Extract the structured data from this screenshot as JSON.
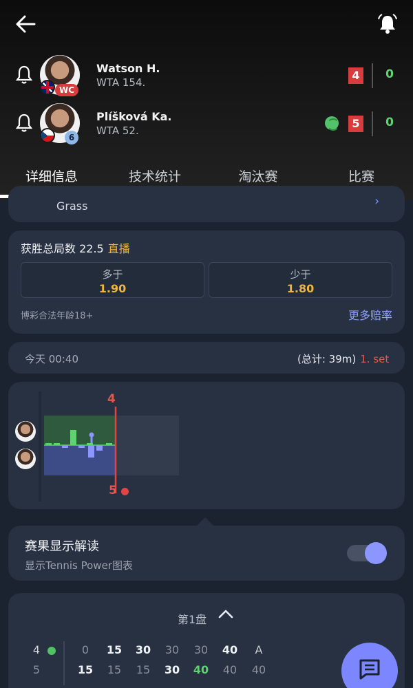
{
  "header": {
    "players": [
      {
        "name": "Watson H.",
        "rank": "WTA 154.",
        "badge": "WC",
        "sets": "4",
        "games": "0",
        "serving": false
      },
      {
        "name": "Plíšková Ka.",
        "rank": "WTA 52.",
        "badge": "6",
        "sets": "5",
        "games": "0",
        "serving": true
      }
    ]
  },
  "tabs": [
    "详细信息",
    "技术统计",
    "淘汰赛",
    "比赛"
  ],
  "surface": {
    "label": "Grass"
  },
  "odds": {
    "title": "获胜总局数 22.5",
    "live": "直播",
    "over_label": "多于",
    "over_value": "1.90",
    "under_label": "少于",
    "under_value": "1.80",
    "legal": "博彩合法年龄18+",
    "more": "更多赔率"
  },
  "timebar": {
    "time": "今天 00:40",
    "total": "(总计: 39m)",
    "set": "1. set"
  },
  "chart": {
    "top_score": "4",
    "bottom_score": "5"
  },
  "power": {
    "title": "赛果显示解读",
    "subtitle": "显示Tennis Power图表",
    "enabled": true
  },
  "set_detail": {
    "title": "第1盘",
    "p1_games": "4",
    "p2_games": "5",
    "p1_points": [
      "0",
      "15",
      "30",
      "30",
      "30",
      "40",
      "A"
    ],
    "p2_points": [
      "15",
      "15",
      "15",
      "30",
      "40",
      "40",
      "40"
    ]
  },
  "colors": {
    "accent": "#7b86ff",
    "live": "#f2b53a",
    "score_red": "#d83c3c",
    "green": "#5fd36f"
  }
}
